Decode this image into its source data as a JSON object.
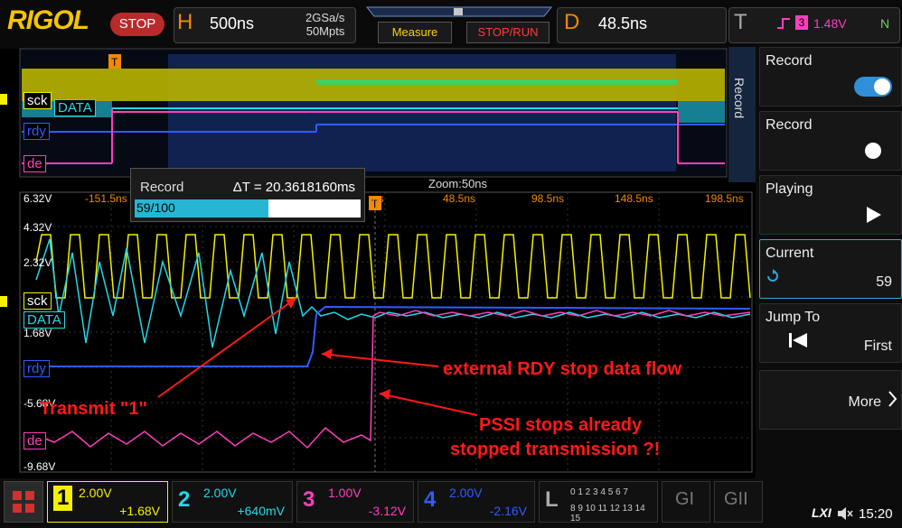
{
  "header": {
    "brand": "RIGOL",
    "run_state": "STOP",
    "horizontal_letter": "H",
    "timebase": "500ns",
    "sample_rate": "2GSa/s",
    "memory_depth": "50Mpts",
    "measure_label": "Measure",
    "stoprun_label": "STOP/RUN",
    "delay_letter": "D",
    "delay": "48.5ns",
    "trigger_letter": "T",
    "trigger_source": "3",
    "trigger_level": "1.48V",
    "trigger_mode": "N"
  },
  "side_menu": {
    "tab_label": "Record",
    "items": [
      {
        "label": "Record",
        "value": ""
      },
      {
        "label": "Record",
        "value": ""
      },
      {
        "label": "Playing",
        "value": ""
      },
      {
        "label": "Current",
        "value": "59"
      },
      {
        "label": "Jump To",
        "value": "First"
      },
      {
        "label": "",
        "value": "More"
      }
    ]
  },
  "record_popup": {
    "label": "Record",
    "delta_t": "ΔT = 20.3618160ms",
    "progress_text": "59/100",
    "progress_fraction": 0.59
  },
  "overview": {
    "zoom_label": "Zoom:50ns",
    "channel_tags": [
      "sck",
      "DATA",
      "rdy",
      "de"
    ]
  },
  "main": {
    "y_labels": [
      "6.32V",
      "4.32V",
      "2.32V",
      "1.68V",
      "-5.68V",
      "-9.68V"
    ],
    "time_labels": [
      "-151.5ns",
      "ns",
      "48.5ns",
      "98.5ns",
      "148.5ns",
      "198.5ns"
    ],
    "channel_tags": [
      "sck",
      "DATA",
      "rdy",
      "de"
    ],
    "annotations": [
      "external RDY stop data flow",
      "Transmit \"1\"",
      "PSSI stops already",
      "stopped transmission ?!"
    ]
  },
  "bottom": {
    "ch1": {
      "num": "1",
      "scale": "2.00V",
      "offset": "+1.68V",
      "color": "#f4f000"
    },
    "ch2": {
      "num": "2",
      "scale": "2.00V",
      "offset": "+640mV",
      "color": "#23d8e8"
    },
    "ch3": {
      "num": "3",
      "scale": "1.00V",
      "offset": "-3.12V",
      "color": "#ff3fbf"
    },
    "ch4": {
      "num": "4",
      "scale": "2.00V",
      "offset": "-2.16V",
      "color": "#2f5cff"
    },
    "logic_label": "L",
    "logic_row1": "0 1 2 3  4 5 6 7",
    "logic_row2": "8 9 10 11  12 13 14 15",
    "gen1": "GI",
    "gen2": "GII",
    "lxi": "LXI",
    "time": "15:20"
  }
}
